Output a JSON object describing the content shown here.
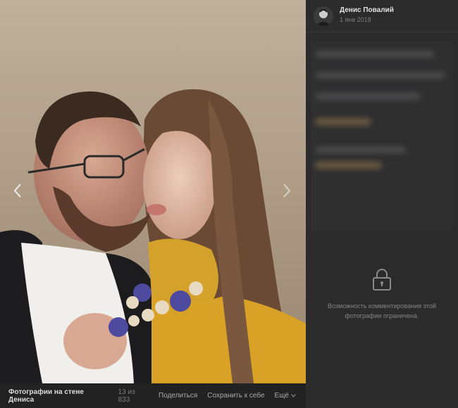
{
  "photo": {
    "subject_icon": "photo"
  },
  "viewer": {
    "album_title": "Фотографии на стене Дениса",
    "counter": "13 из 833",
    "share_label": "Поделиться",
    "save_label": "Сохранить к себе",
    "more_label": "Ещё"
  },
  "post": {
    "author_name": "Денис Повалий",
    "date": "1 янв 2018"
  },
  "comments": {
    "restricted_text": "Возможность комментирования этой фотографии ограничена.",
    "icon": "lock-icon"
  },
  "colors": {
    "panel_bg": "#2b2b2c",
    "bar_bg": "#222223",
    "text_primary": "#e1e1e1",
    "text_muted": "#7d7d7f"
  }
}
